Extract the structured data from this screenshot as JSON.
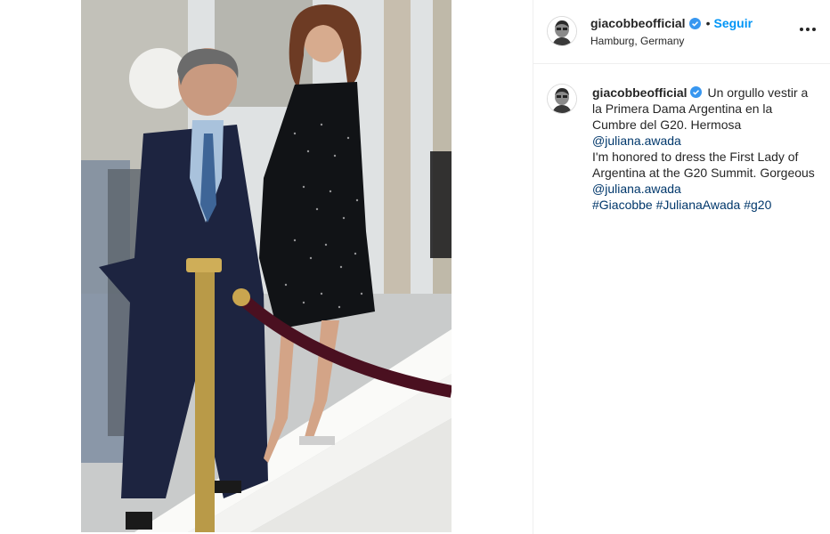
{
  "post": {
    "username": "giacobbeofficial",
    "follow_label": "Seguir",
    "separator": "•",
    "location": "Hamburg, Germany"
  },
  "caption": {
    "username": "giacobbeofficial",
    "spanish_text": "Un orgullo vestir a la Primera Dama Argentina en la Cumbre del G20. Hermosa",
    "mention_1": "@juliana.awada",
    "english_text": "I'm honored to dress the First Lady of Argentina at the G20 Summit. Gorgeous",
    "mention_2": "@juliana.awada",
    "hashtags": [
      "#Giacobbe",
      "#JulianaAwada",
      "#g20"
    ]
  },
  "icons": {
    "verified": "verified-badge-icon",
    "more": "more-options-icon"
  },
  "colors": {
    "accent": "#0095f6",
    "link": "#00376b",
    "verified": "#3897f0",
    "text": "#262626",
    "border": "#efefef"
  }
}
